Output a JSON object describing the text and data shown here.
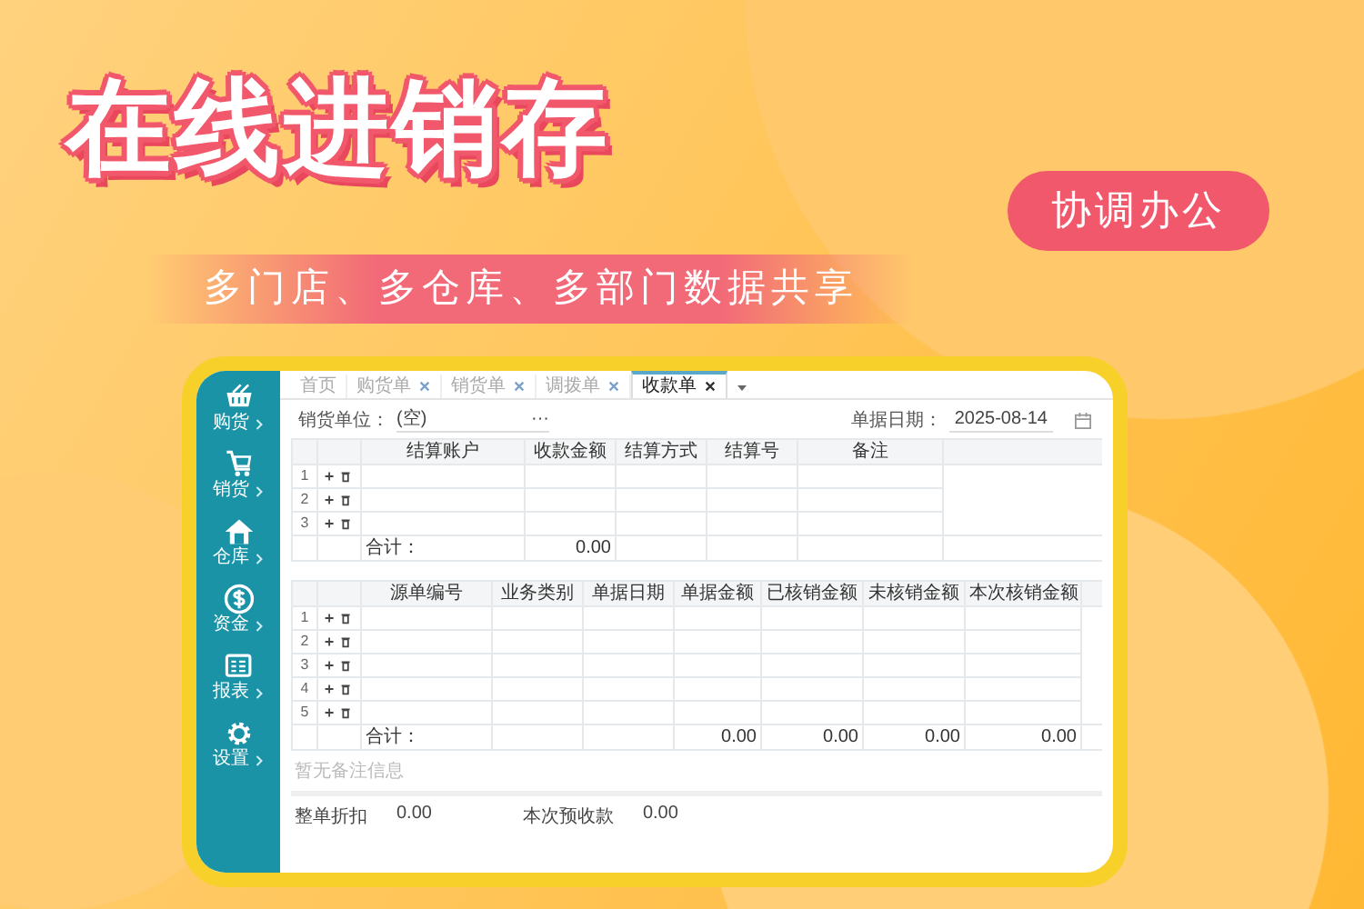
{
  "headline": "在线进销存",
  "badge": "协调办公",
  "subtitle": "多门店、多仓库、多部门数据共享",
  "app": {
    "sidebar": [
      {
        "label": "购货",
        "kind": "basket"
      },
      {
        "label": "销货",
        "kind": "cart"
      },
      {
        "label": "仓库",
        "kind": "house"
      },
      {
        "label": "资金",
        "kind": "coin"
      },
      {
        "label": "报表",
        "kind": "report"
      },
      {
        "label": "设置",
        "kind": "gear"
      }
    ],
    "tabs": [
      {
        "label": "首页",
        "closable": false,
        "selected": false
      },
      {
        "label": "购货单",
        "closable": true,
        "selected": false
      },
      {
        "label": "销货单",
        "closable": true,
        "selected": false
      },
      {
        "label": "调拨单",
        "closable": true,
        "selected": false
      },
      {
        "label": "收款单",
        "closable": true,
        "selected": true
      }
    ],
    "customer": {
      "label": "销货单位：",
      "value": "(空)",
      "more": "···"
    },
    "date": {
      "label": "单据日期：",
      "value": "2025-08-14"
    },
    "table_1": {
      "columns": [
        {
          "title": "结算账户"
        },
        {
          "title": "收款金额",
          "total": "0.00"
        },
        {
          "title": "结算方式"
        },
        {
          "title": "结算号"
        },
        {
          "title": "备注"
        }
      ],
      "rows": [
        "1",
        "2",
        "3"
      ],
      "total_label": "合计："
    },
    "table_2": {
      "columns": [
        {
          "title": "源单编号"
        },
        {
          "title": "业务类别"
        },
        {
          "title": "单据日期"
        },
        {
          "title": "单据金额",
          "total": "0.00"
        },
        {
          "title": "已核销金额",
          "total": "0.00"
        },
        {
          "title": "未核销金额",
          "total": "0.00"
        },
        {
          "title": "本次核销金额",
          "total": "0.00"
        }
      ],
      "rows": [
        "1",
        "2",
        "3",
        "4",
        "5"
      ],
      "total_label": "合计："
    },
    "note": {
      "placeholder": "暂无备注信息"
    },
    "footer": [
      {
        "label": "整单折扣",
        "value": "0.00"
      },
      {
        "label": "本次预收款",
        "value": "0.00"
      }
    ]
  }
}
